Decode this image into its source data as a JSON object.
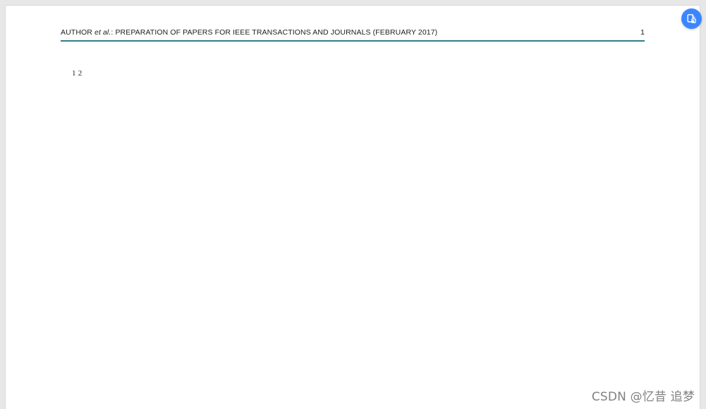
{
  "document": {
    "header_author": "AUTHOR",
    "header_italic": "et al.",
    "header_title": ": PREPARATION OF PAPERS FOR IEEE TRANSACTIONS AND JOURNALS (FEBRUARY 2017)",
    "page_number": "1",
    "body_text": "1 2"
  },
  "ui": {
    "floating_button_icon": "document-share-icon",
    "watermark": "CSDN @忆昔 追梦",
    "accent_color": "#3b86ff",
    "rule_color": "#2d7f83"
  }
}
